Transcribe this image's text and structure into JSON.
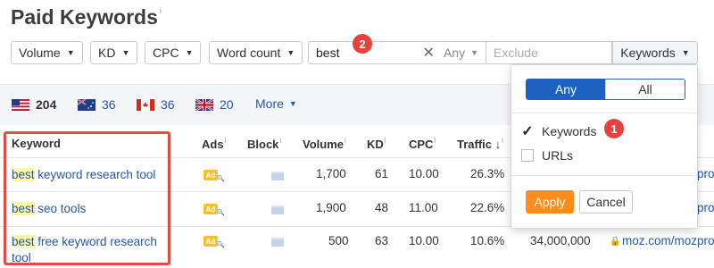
{
  "page": {
    "title": "Paid Keywords",
    "title_info": "i"
  },
  "filters": {
    "volume": "Volume",
    "kd": "KD",
    "cpc": "CPC",
    "word_count": "Word count",
    "search_value": "best",
    "clear": "✕",
    "match": "Any",
    "exclude_placeholder": "Exclude",
    "scope": "Keywords"
  },
  "annotations": {
    "one": "1",
    "two": "2"
  },
  "countries": [
    {
      "code": "US",
      "count": "204"
    },
    {
      "code": "AU",
      "count": "36"
    },
    {
      "code": "CA",
      "count": "36"
    },
    {
      "code": "GB",
      "count": "20"
    }
  ],
  "more": "More",
  "table": {
    "headers": {
      "keyword": "Keyword",
      "ads": "Ads",
      "block": "Block",
      "volume": "Volume",
      "kd": "KD",
      "cpc": "CPC",
      "traffic": "Traffic",
      "info": "i",
      "sort_arrow": "↓"
    },
    "rows": [
      {
        "kw_hl": "best",
        "kw_rest": " keyword research tool",
        "kw_wrap": "",
        "ad": "Ad",
        "volume": "1,700",
        "kd": "61",
        "cpc": "10.00",
        "traffic": "26.3%",
        "value": "",
        "url": "moz.com/mozpro"
      },
      {
        "kw_hl": "best",
        "kw_rest": " seo tools",
        "kw_wrap": "",
        "ad": "Ad",
        "volume": "1,900",
        "kd": "48",
        "cpc": "11.00",
        "traffic": "22.6%",
        "value": "",
        "url": "moz.com/mozpro"
      },
      {
        "kw_hl": "best",
        "kw_rest": " free keyword research",
        "kw_wrap": "tool",
        "ad": "Ad",
        "volume": "500",
        "kd": "63",
        "cpc": "10.00",
        "traffic": "10.6%",
        "value": "34,000,000",
        "url": "moz.com/mozpro"
      }
    ]
  },
  "popup": {
    "seg_any": "Any",
    "seg_all": "All",
    "opt_keywords": "Keywords",
    "opt_urls": "URLs",
    "apply": "Apply",
    "cancel": "Cancel"
  },
  "colors": {
    "accent": "#1e62c1",
    "apply": "#ff8c1a",
    "badge": "#e8413b",
    "link": "#2457a8"
  }
}
